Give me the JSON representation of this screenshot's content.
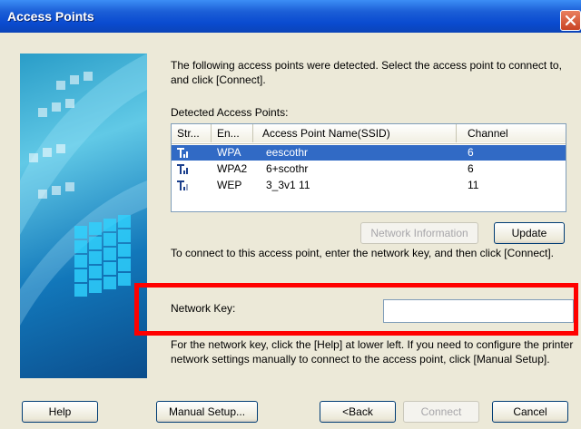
{
  "window": {
    "title": "Access Points"
  },
  "intro_text": "The following access points were detected. Select the access point to connect to, and click [Connect].",
  "detected_label": "Detected Access Points:",
  "list": {
    "columns": [
      "Str...",
      "En...",
      "Access Point Name(SSID)",
      "Channel"
    ],
    "rows": [
      {
        "signal_icon": "signal-strength-icon",
        "encryption": "WPA",
        "ssid": "eescothr",
        "channel": "6",
        "selected": true
      },
      {
        "signal_icon": "signal-strength-icon",
        "encryption": "WPA2",
        "ssid": "6+scothr",
        "channel": "6",
        "selected": false
      },
      {
        "signal_icon": "signal-strength-icon",
        "encryption": "WEP",
        "ssid": "3_3v1 11",
        "channel": "11",
        "selected": false
      }
    ]
  },
  "buttons": {
    "network_information": "Network Information",
    "update": "Update",
    "help": "Help",
    "manual_setup": "Manual Setup...",
    "back": "<Back",
    "connect": "Connect",
    "cancel": "Cancel"
  },
  "connect_text": "To connect to this access point, enter the network key, and then click [Connect].",
  "network_key": {
    "label": "Network Key:",
    "value": ""
  },
  "help_text": "For the network key, click the [Help] at lower left. If you need to configure the printer network settings manually to connect to the access point, click [Manual Setup].",
  "colors": {
    "title_bar": "#0a4bd0",
    "selection": "#316ac5",
    "highlight": "#ff0000"
  }
}
